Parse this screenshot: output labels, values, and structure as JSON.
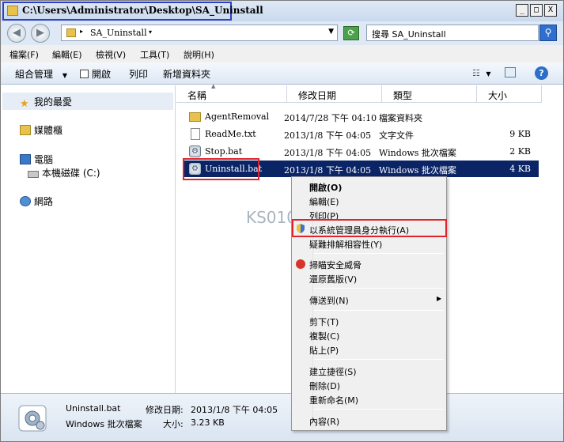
{
  "window": {
    "title": "C:\\Users\\Administrator\\Desktop\\SA_Uninstall",
    "buttons": {
      "minimize": "_",
      "maximize": "□",
      "close": "X"
    }
  },
  "address": {
    "path": "SA_Uninstall",
    "breadcrumb_sep": "▸",
    "search_placeholder": "搜尋 SA_Uninstall"
  },
  "menubar": {
    "items": [
      "檔案(F)",
      "編輯(E)",
      "檢視(V)",
      "工具(T)",
      "說明(H)"
    ]
  },
  "toolbar": {
    "organize": "組合管理",
    "open": "開啟",
    "print": "列印",
    "new_folder": "新增資料夾"
  },
  "navpane": {
    "favorites": "我的最愛",
    "libraries": "媒體櫃",
    "computer": "電腦",
    "local_disk": "本機磁碟 (C:)",
    "network": "網路"
  },
  "columns": {
    "name": "名稱",
    "date": "修改日期",
    "type": "類型",
    "size": "大小"
  },
  "files": [
    {
      "name": "AgentRemoval",
      "date": "2014/7/28 下午 04:10",
      "type": "檔案資料夾",
      "size": "",
      "icon": "folder-icon"
    },
    {
      "name": "ReadMe.txt",
      "date": "2013/1/8 下午 04:05",
      "type": "文字文件",
      "size": "9 KB",
      "icon": "text-file-icon"
    },
    {
      "name": "Stop.bat",
      "date": "2013/1/8 下午 04:05",
      "type": "Windows 批次檔案",
      "size": "2 KB",
      "icon": "batch-file-icon"
    },
    {
      "name": "Uninstall.bat",
      "date": "2013/1/8 下午 04:05",
      "type": "Windows 批次檔案",
      "size": "4 KB",
      "icon": "batch-file-icon"
    }
  ],
  "context_menu": {
    "open": "開啟(O)",
    "edit": "編輯(E)",
    "print": "列印(P)",
    "run_as_admin": "以系統管理員身分執行(A)",
    "troubleshoot": "疑難排解相容性(Y)",
    "scan": "掃瞄安全威脅",
    "restore": "還原舊版(V)",
    "send_to": "傳送到(N)",
    "cut": "剪下(T)",
    "copy": "複製(C)",
    "paste": "貼上(P)",
    "shortcut": "建立捷徑(S)",
    "delete": "刪除(D)",
    "rename": "重新命名(M)",
    "properties": "內容(R)"
  },
  "details": {
    "filename": "Uninstall.bat",
    "modified_label": "修改日期:",
    "modified_value": "2013/1/8 下午 04:05",
    "type": "Windows 批次檔案",
    "size_label": "大小:",
    "size_value": "3.23 KB"
  },
  "watermark": "KS010S",
  "colors": {
    "selection": "#0a2466",
    "highlight_box": "#e0242b",
    "title_box": "#2d3fc8"
  }
}
